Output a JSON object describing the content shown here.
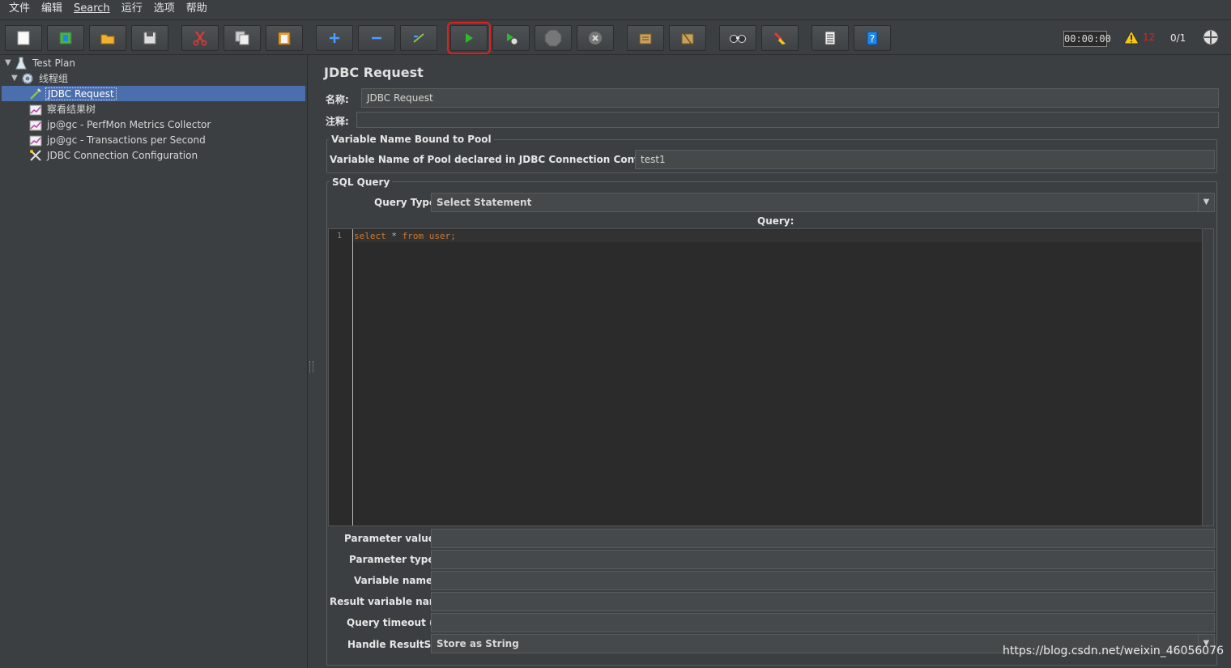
{
  "menubar": {
    "items": [
      "文件",
      "编辑",
      "Search",
      "运行",
      "选项",
      "帮助"
    ]
  },
  "toolbar": {
    "buttons": [
      {
        "name": "new-icon"
      },
      {
        "name": "templates-icon"
      },
      {
        "name": "open-icon"
      },
      {
        "name": "save-icon"
      },
      {
        "name": "cut-icon"
      },
      {
        "name": "copy-icon"
      },
      {
        "name": "paste-icon"
      },
      {
        "name": "expand-icon"
      },
      {
        "name": "collapse-icon"
      },
      {
        "name": "toggle-icon"
      },
      {
        "name": "start-icon"
      },
      {
        "name": "start-no-pauses-icon"
      },
      {
        "name": "stop-icon"
      },
      {
        "name": "shutdown-icon"
      },
      {
        "name": "remote-start-icon"
      },
      {
        "name": "remote-stop-icon"
      },
      {
        "name": "search-icon"
      },
      {
        "name": "clear-all-icon"
      },
      {
        "name": "function-helper-icon"
      },
      {
        "name": "help-icon"
      }
    ],
    "timer": "00:00:00",
    "warning_count": "12",
    "thread_ratio": "0/1"
  },
  "tree": {
    "items": [
      {
        "label": "Test Plan",
        "icon": "test-plan-icon"
      },
      {
        "label": "线程组",
        "icon": "thread-group-icon"
      },
      {
        "label": "JDBC Request",
        "icon": "sampler-icon"
      },
      {
        "label": "察看结果树",
        "icon": "listener-icon"
      },
      {
        "label": "jp@gc - PerfMon Metrics Collector",
        "icon": "listener-icon"
      },
      {
        "label": "jp@gc - Transactions per Second",
        "icon": "listener-icon"
      },
      {
        "label": "JDBC Connection Configuration",
        "icon": "config-icon"
      }
    ]
  },
  "main": {
    "title": "JDBC Request",
    "name_label": "名称:",
    "name_value": "JDBC Request",
    "comment_label": "注释:",
    "comment_value": "",
    "pool_group_title": "Variable Name Bound to Pool",
    "pool_label": "Variable Name of Pool declared in JDBC Connection Configuration:",
    "pool_value": "test1",
    "sql_group_title": "SQL Query",
    "query_type_label": "Query Type:",
    "query_type_value": "Select Statement",
    "query_label": "Query:",
    "editor": {
      "line_number": "1",
      "tokens": [
        "select",
        " * ",
        "from",
        " user;"
      ]
    },
    "fields": [
      {
        "label": "Parameter values:",
        "value": ""
      },
      {
        "label": "Parameter types:",
        "value": ""
      },
      {
        "label": "Variable names:",
        "value": ""
      },
      {
        "label": "Result variable name:",
        "value": ""
      },
      {
        "label": "Query timeout (s):",
        "value": ""
      },
      {
        "label": "Handle ResultSet:",
        "value": "Store as String"
      }
    ]
  },
  "watermark": "https://blog.csdn.net/weixin_46056076"
}
